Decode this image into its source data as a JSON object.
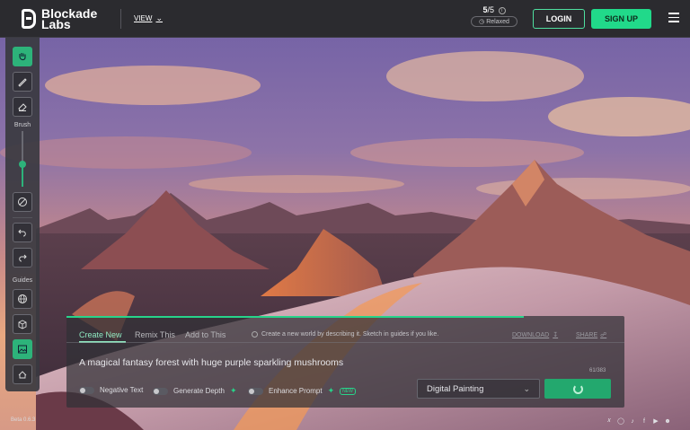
{
  "brand": {
    "line1": "Blockade",
    "line2": "Labs"
  },
  "header": {
    "view_label": "VIEW",
    "credits_used": "5",
    "credits_total": "/5",
    "mode_label": "Relaxed",
    "login_label": "LOGIN",
    "signup_label": "SIGN UP"
  },
  "toolbar": {
    "brush_label": "Brush",
    "guides_label": "Guides",
    "brush_size": 0.4,
    "tools": [
      "hand-icon",
      "pencil-icon",
      "eraser-icon",
      "clear-icon",
      "undo-icon",
      "redo-icon",
      "globe-icon",
      "cube-icon",
      "image-icon",
      "panorama-icon"
    ]
  },
  "panel": {
    "tabs": [
      {
        "label": "Create New"
      },
      {
        "label": "Remix This"
      },
      {
        "label": "Add to This"
      }
    ],
    "hint": "Create a new world by describing it. Sketch in guides if you like.",
    "download_label": "DOWNLOAD",
    "share_label": "SHARE",
    "prompt_value": "A magical fantasy forest with huge purple sparkling mushrooms",
    "char_count": "61/383",
    "toggles": {
      "negative": "Negative Text",
      "depth": "Generate Depth",
      "enhance": "Enhance Prompt",
      "new_badge": "NEW"
    },
    "style_value": "Digital Painting",
    "progress": 0.82
  },
  "footer": {
    "version": "Beta 0.6.3",
    "socials": [
      "twitter-icon",
      "instagram-icon",
      "tiktok-icon",
      "facebook-icon",
      "youtube-icon",
      "discord-icon"
    ]
  },
  "colors": {
    "accent": "#21d98a",
    "topbar": "#2b2b2f"
  }
}
